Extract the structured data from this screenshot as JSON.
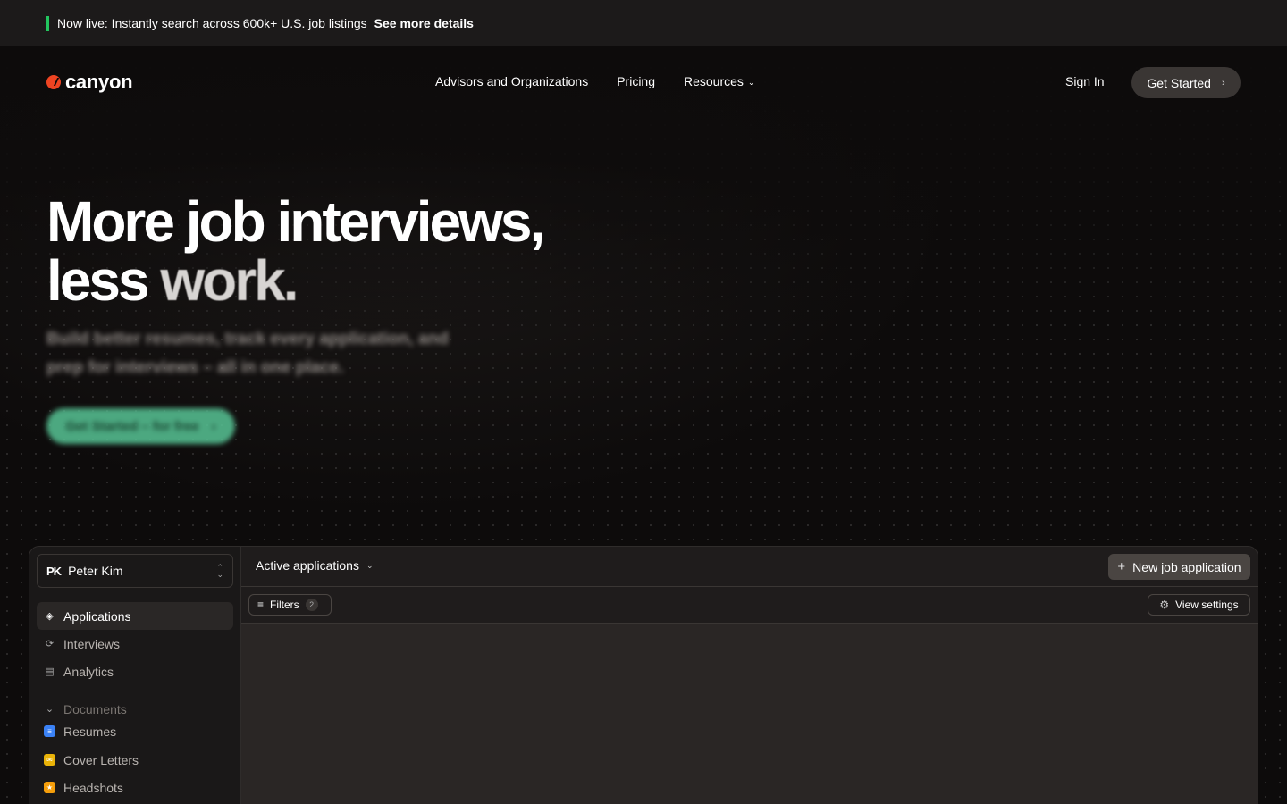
{
  "announcement": {
    "text": "Now live: Instantly search across 600k+ U.S. job listings",
    "link": "See more details",
    "accent_color": "#22c55e"
  },
  "nav": {
    "logo": "canyon",
    "links": [
      "Advisors and Organizations",
      "Pricing",
      "Resources"
    ],
    "sign_in": "Sign In",
    "get_started": "Get Started"
  },
  "hero": {
    "headline_line1": "More job interviews,",
    "headline_less": "less ",
    "headline_work": "work.",
    "subtext": "Build better resumes, track every application, and prep for interviews – all in one place.",
    "cta": "Get Started – for free",
    "cta_color": "#57c495"
  },
  "app": {
    "user": {
      "initials": "PK",
      "name": "Peter Kim"
    },
    "sidebar": {
      "items": [
        "Applications",
        "Interviews",
        "Analytics"
      ],
      "documents_header": "Documents",
      "documents": [
        {
          "label": "Resumes",
          "color": "#3b82f6"
        },
        {
          "label": "Cover Letters",
          "color": "#eab308"
        },
        {
          "label": "Headshots",
          "color": "#f59e0b"
        }
      ]
    },
    "main": {
      "view_title": "Active applications",
      "new_button": "New job application",
      "filters_label": "Filters",
      "filters_count": "2",
      "view_settings": "View settings"
    }
  }
}
